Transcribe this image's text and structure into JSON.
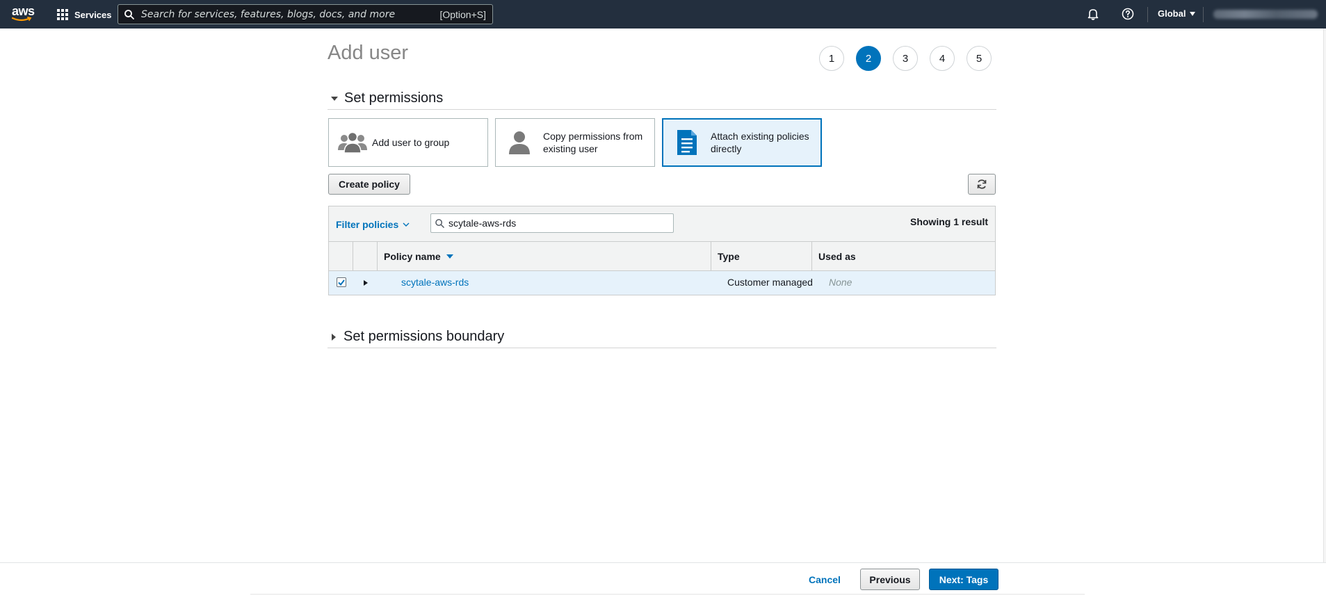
{
  "nav": {
    "logo_text": "aws",
    "services_label": "Services",
    "search_placeholder": "Search for services, features, blogs, docs, and more",
    "search_shortcut": "[Option+S]",
    "region_label": "Global",
    "icons": [
      "bell-icon",
      "help-icon"
    ]
  },
  "page": {
    "title": "Add user",
    "steps": [
      "1",
      "2",
      "3",
      "4",
      "5"
    ],
    "active_step": "2"
  },
  "permissions": {
    "section_title": "Set permissions",
    "options": [
      {
        "label": "Add user to group",
        "icon": "group-icon",
        "selected": false
      },
      {
        "label": "Copy permissions from existing user",
        "icon": "user-icon",
        "selected": false
      },
      {
        "label": "Attach existing policies directly",
        "icon": "document-icon",
        "selected": true
      }
    ],
    "create_policy_label": "Create policy",
    "filter_label": "Filter policies",
    "search_value": "scytale-aws-rds",
    "showing_text": "Showing 1 result",
    "columns": [
      "Policy name",
      "Type",
      "Used as"
    ],
    "rows": [
      {
        "checked": true,
        "name": "scytale-aws-rds",
        "type": "Customer managed",
        "used_as": "None"
      }
    ]
  },
  "boundary": {
    "section_title": "Set permissions boundary"
  },
  "footer": {
    "cancel_label": "Cancel",
    "previous_label": "Previous",
    "next_label": "Next: Tags"
  },
  "colors": {
    "nav_bg": "#232f3e",
    "accent": "#0073bb",
    "selected_bg": "#e6f2fb"
  }
}
